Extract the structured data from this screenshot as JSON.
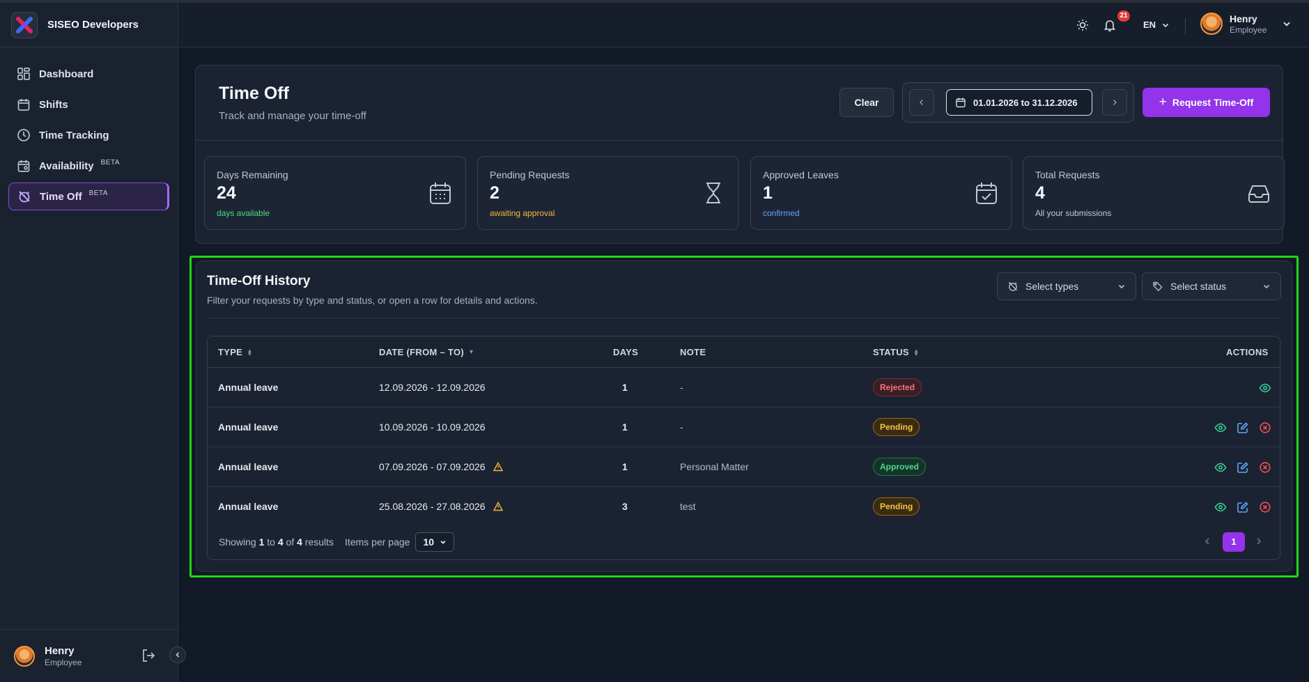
{
  "brand": {
    "name": "SISEO Developers"
  },
  "sidebar": {
    "items": [
      {
        "label": "Dashboard",
        "icon": "grid-icon"
      },
      {
        "label": "Shifts",
        "icon": "calendar-icon"
      },
      {
        "label": "Time Tracking",
        "icon": "clock-icon"
      },
      {
        "label": "Availability",
        "icon": "calendar-user-icon",
        "badge": "BETA"
      },
      {
        "label": "Time Off",
        "icon": "alarm-off-icon",
        "badge": "BETA",
        "active": true
      }
    ],
    "user": {
      "name": "Henry",
      "role": "Employee"
    }
  },
  "topbar": {
    "notifications_count": "21",
    "language": "EN",
    "user": {
      "name": "Henry",
      "role": "Employee"
    }
  },
  "header": {
    "title": "Time Off",
    "subtitle": "Track and manage your time-off",
    "clear_label": "Clear",
    "date_range": "01.01.2026 to 31.12.2026",
    "request_label": "Request Time-Off"
  },
  "stats": [
    {
      "label": "Days Remaining",
      "value": "24",
      "sub": "days available",
      "sub_color": "#4ade80",
      "icon": "calendar-grid-icon"
    },
    {
      "label": "Pending Requests",
      "value": "2",
      "sub": "awaiting approval",
      "sub_color": "#f5b73b",
      "icon": "hourglass-icon"
    },
    {
      "label": "Approved Leaves",
      "value": "1",
      "sub": "confirmed",
      "sub_color": "#60a5fa",
      "icon": "calendar-check-icon"
    },
    {
      "label": "Total Requests",
      "value": "4",
      "sub": "All your submissions",
      "sub_color": "#c2c8d2",
      "icon": "inbox-icon"
    }
  ],
  "history": {
    "title": "Time-Off History",
    "subtitle": "Filter your requests by type and status, or open a row for details and actions.",
    "filter_types_placeholder": "Select types",
    "filter_status_placeholder": "Select status",
    "columns": {
      "type": "TYPE",
      "date": "DATE (FROM – TO)",
      "days": "DAYS",
      "note": "NOTE",
      "status": "STATUS",
      "actions": "ACTIONS"
    },
    "rows": [
      {
        "type": "Annual leave",
        "date": "12.09.2026 - 12.09.2026",
        "days": "1",
        "note": "-",
        "status": "Rejected",
        "warning": false,
        "editable": false
      },
      {
        "type": "Annual leave",
        "date": "10.09.2026 - 10.09.2026",
        "days": "1",
        "note": "-",
        "status": "Pending",
        "warning": false,
        "editable": true
      },
      {
        "type": "Annual leave",
        "date": "07.09.2026 - 07.09.2026",
        "days": "1",
        "note": "Personal Matter",
        "status": "Approved",
        "warning": true,
        "editable": true
      },
      {
        "type": "Annual leave",
        "date": "25.08.2026 - 27.08.2026",
        "days": "3",
        "note": "test",
        "status": "Pending",
        "warning": true,
        "editable": true
      }
    ],
    "footer": {
      "showing": "Showing",
      "from": "1",
      "to_word": "to",
      "to": "4",
      "of_word": "of",
      "total": "4",
      "results_word": "results",
      "per_page_label": "Items per page",
      "per_page_value": "10",
      "current_page": "1"
    }
  }
}
